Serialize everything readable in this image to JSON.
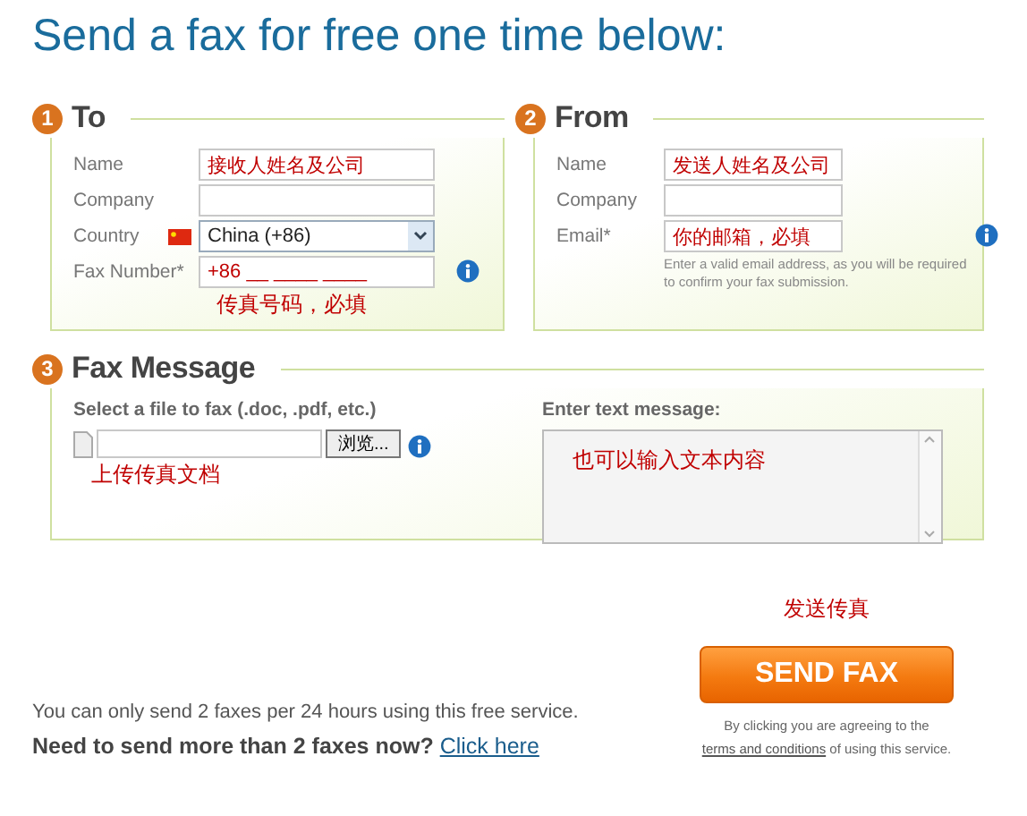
{
  "title": "Send a fax for free one time below:",
  "to": {
    "number": "1",
    "heading": "To",
    "fields": [
      {
        "kind": "text",
        "label": "Name",
        "value": "接收人姓名及公司"
      },
      {
        "kind": "text",
        "label": "Company"
      },
      {
        "kind": "select",
        "label": "Country",
        "value": "China (+86)"
      },
      {
        "kind": "text",
        "label": "Fax Number*",
        "value": "+86 __ ____ ____",
        "info": true,
        "note": "传真号码，必填"
      }
    ]
  },
  "from": {
    "number": "2",
    "heading": "From",
    "fields": [
      {
        "kind": "text",
        "label": "Name",
        "value": "发送人姓名及公司"
      },
      {
        "kind": "text",
        "label": "Company"
      },
      {
        "kind": "text",
        "label": "Email*",
        "value": "你的邮箱，必填",
        "info": true,
        "hint": "Enter a valid email address, as you will be required to confirm your fax submission."
      }
    ]
  },
  "message": {
    "number": "3",
    "heading": "Fax Message",
    "file_label": "Select a file to fax (.doc, .pdf, etc.)",
    "browse": "浏览...",
    "file_note": "上传传真文档",
    "text_label": "Enter text message:",
    "text_value": "也可以输入文本内容"
  },
  "limit_text": "You can only send 2 faxes per 24 hours using this free service.",
  "more_text": "Need to send more than 2 faxes now?",
  "more_link": "Click here",
  "send_note": "发送传真",
  "send_button": "SEND FAX",
  "terms_before": "By clicking you are agreeing to the",
  "terms_link": "terms and conditions",
  "terms_after": "of using this service."
}
